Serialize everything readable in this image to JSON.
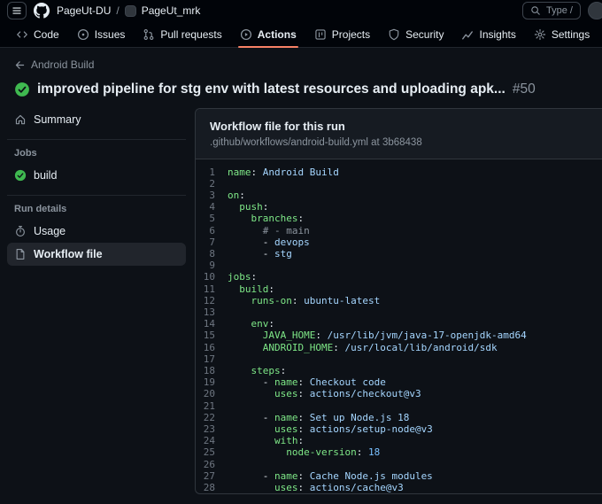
{
  "topbar": {
    "org": "PageUt-DU",
    "separator": "/",
    "repo": "PageUt_mrk",
    "search_placeholder": "Type /"
  },
  "nav": {
    "tabs": [
      {
        "label": "Code",
        "icon": "code-icon",
        "active": false
      },
      {
        "label": "Issues",
        "icon": "issue-opened-icon",
        "active": false
      },
      {
        "label": "Pull requests",
        "icon": "git-pull-request-icon",
        "active": false
      },
      {
        "label": "Actions",
        "icon": "play-circle-icon",
        "active": true
      },
      {
        "label": "Projects",
        "icon": "table-icon",
        "active": false
      },
      {
        "label": "Security",
        "icon": "shield-icon",
        "active": false
      },
      {
        "label": "Insights",
        "icon": "graph-icon",
        "active": false
      },
      {
        "label": "Settings",
        "icon": "gear-icon",
        "active": false
      }
    ]
  },
  "header": {
    "back_label": "Android Build",
    "run_title": "improved pipeline for stg env with latest resources and uploading apk...",
    "run_number": "#50"
  },
  "sidebar": {
    "summary": {
      "label": "Summary",
      "icon": "home-icon",
      "selected": false
    },
    "sections": [
      {
        "heading": "Jobs",
        "items": [
          {
            "label": "build",
            "icon": "check-circle-icon",
            "selected": false
          }
        ]
      },
      {
        "heading": "Run details",
        "items": [
          {
            "label": "Usage",
            "icon": "stopwatch-icon",
            "selected": false
          },
          {
            "label": "Workflow file",
            "icon": "workflow-file-icon",
            "selected": true
          }
        ]
      }
    ]
  },
  "card": {
    "title": "Workflow file for this run",
    "subtitle": ".github/workflows/android-build.yml at 3b68438"
  },
  "code": {
    "lines": [
      {
        "n": 1,
        "seg": [
          [
            "k",
            "name"
          ],
          [
            "p",
            ": "
          ],
          [
            "v",
            "Android Build"
          ]
        ]
      },
      {
        "n": 2,
        "seg": []
      },
      {
        "n": 3,
        "seg": [
          [
            "k",
            "on"
          ],
          [
            "p",
            ":"
          ]
        ]
      },
      {
        "n": 4,
        "seg": [
          [
            "p",
            "  "
          ],
          [
            "k",
            "push"
          ],
          [
            "p",
            ":"
          ]
        ]
      },
      {
        "n": 5,
        "seg": [
          [
            "p",
            "    "
          ],
          [
            "k",
            "branches"
          ],
          [
            "p",
            ":"
          ]
        ]
      },
      {
        "n": 6,
        "seg": [
          [
            "p",
            "      "
          ],
          [
            "c",
            "# - main"
          ]
        ]
      },
      {
        "n": 7,
        "seg": [
          [
            "p",
            "      - "
          ],
          [
            "v",
            "devops"
          ]
        ]
      },
      {
        "n": 8,
        "seg": [
          [
            "p",
            "      - "
          ],
          [
            "v",
            "stg"
          ]
        ]
      },
      {
        "n": 9,
        "seg": []
      },
      {
        "n": 10,
        "seg": [
          [
            "k",
            "jobs"
          ],
          [
            "p",
            ":"
          ]
        ]
      },
      {
        "n": 11,
        "seg": [
          [
            "p",
            "  "
          ],
          [
            "k",
            "build"
          ],
          [
            "p",
            ":"
          ]
        ]
      },
      {
        "n": 12,
        "seg": [
          [
            "p",
            "    "
          ],
          [
            "k",
            "runs-on"
          ],
          [
            "p",
            ": "
          ],
          [
            "v",
            "ubuntu-latest"
          ]
        ]
      },
      {
        "n": 13,
        "seg": []
      },
      {
        "n": 14,
        "seg": [
          [
            "p",
            "    "
          ],
          [
            "k",
            "env"
          ],
          [
            "p",
            ":"
          ]
        ]
      },
      {
        "n": 15,
        "seg": [
          [
            "p",
            "      "
          ],
          [
            "k",
            "JAVA_HOME"
          ],
          [
            "p",
            ": "
          ],
          [
            "v",
            "/usr/lib/jvm/java-17-openjdk-amd64"
          ]
        ]
      },
      {
        "n": 16,
        "seg": [
          [
            "p",
            "      "
          ],
          [
            "k",
            "ANDROID_HOME"
          ],
          [
            "p",
            ": "
          ],
          [
            "v",
            "/usr/local/lib/android/sdk"
          ]
        ]
      },
      {
        "n": 17,
        "seg": []
      },
      {
        "n": 18,
        "seg": [
          [
            "p",
            "    "
          ],
          [
            "k",
            "steps"
          ],
          [
            "p",
            ":"
          ]
        ]
      },
      {
        "n": 19,
        "seg": [
          [
            "p",
            "      - "
          ],
          [
            "k",
            "name"
          ],
          [
            "p",
            ": "
          ],
          [
            "v",
            "Checkout code"
          ]
        ]
      },
      {
        "n": 20,
        "seg": [
          [
            "p",
            "        "
          ],
          [
            "k",
            "uses"
          ],
          [
            "p",
            ": "
          ],
          [
            "v",
            "actions/checkout@v3"
          ]
        ]
      },
      {
        "n": 21,
        "seg": []
      },
      {
        "n": 22,
        "seg": [
          [
            "p",
            "      - "
          ],
          [
            "k",
            "name"
          ],
          [
            "p",
            ": "
          ],
          [
            "v",
            "Set up Node.js 18"
          ]
        ]
      },
      {
        "n": 23,
        "seg": [
          [
            "p",
            "        "
          ],
          [
            "k",
            "uses"
          ],
          [
            "p",
            ": "
          ],
          [
            "v",
            "actions/setup-node@v3"
          ]
        ]
      },
      {
        "n": 24,
        "seg": [
          [
            "p",
            "        "
          ],
          [
            "k",
            "with"
          ],
          [
            "p",
            ":"
          ]
        ]
      },
      {
        "n": 25,
        "seg": [
          [
            "p",
            "          "
          ],
          [
            "k",
            "node-version"
          ],
          [
            "p",
            ": "
          ],
          [
            "n2",
            "18"
          ]
        ]
      },
      {
        "n": 26,
        "seg": []
      },
      {
        "n": 27,
        "seg": [
          [
            "p",
            "      - "
          ],
          [
            "k",
            "name"
          ],
          [
            "p",
            ": "
          ],
          [
            "v",
            "Cache Node.js modules"
          ]
        ]
      },
      {
        "n": 28,
        "seg": [
          [
            "p",
            "        "
          ],
          [
            "k",
            "uses"
          ],
          [
            "p",
            ": "
          ],
          [
            "v",
            "actions/cache@v3"
          ]
        ]
      }
    ]
  },
  "colors": {
    "accent_tab_underline": "#f78166",
    "success_green": "#3fb950",
    "syntax_key": "#7ee787",
    "syntax_string": "#a5d6ff",
    "syntax_number": "#79c0ff",
    "syntax_comment": "#8b949e"
  }
}
